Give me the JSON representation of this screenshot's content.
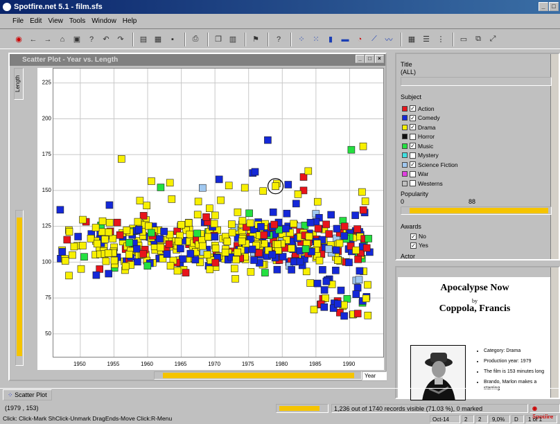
{
  "window": {
    "title": "Spotfire.net 5.1 - film.sfs"
  },
  "menu": [
    "File",
    "Edit",
    "View",
    "Tools",
    "Window",
    "Help"
  ],
  "toolbar_icons": [
    "back-icon",
    "forward-icon",
    "home-icon",
    "open-icon",
    "save-icon",
    "print-icon",
    "copy-icon",
    "paste-icon",
    "filter-icon",
    "help-icon",
    "scatter-icon",
    "bar-chart-icon",
    "pie-chart-icon",
    "line-chart-icon",
    "table-icon",
    "details-icon",
    "new-window-icon",
    "zoom-icon"
  ],
  "plot": {
    "title": "Scatter Plot - Year vs. Length",
    "y_axis_button": "Length",
    "x_axis_select": "Year",
    "tab_label": "Scatter Plot"
  },
  "chart_data": {
    "type": "scatter",
    "title": "Scatter Plot - Year vs. Length",
    "xlabel": "Year",
    "ylabel": "Length",
    "xlim": [
      1946,
      1995
    ],
    "ylim": [
      34,
      235
    ],
    "x_ticks": [
      "1950",
      "1955",
      "1960",
      "1965",
      "1970",
      "1975",
      "1980",
      "1985",
      "1990"
    ],
    "y_ticks": [
      "225",
      "200",
      "175",
      "150",
      "125",
      "100",
      "75",
      "50"
    ],
    "grid": true,
    "marker": "square",
    "series_colors": {
      "Action": "#e8141b",
      "Comedy": "#1428d8",
      "Drama": "#f8f000",
      "Music": "#24e040",
      "Science Fiction": "#a0c8f0"
    },
    "highlight": {
      "x": 1979,
      "y": 153
    }
  },
  "panel": {
    "title_label": "Title",
    "title_value": "(ALL)",
    "subject_label": "Subject",
    "subjects": [
      {
        "label": "Action",
        "color": "#e8141b",
        "checked": true
      },
      {
        "label": "Comedy",
        "color": "#1428d8",
        "checked": true
      },
      {
        "label": "Drama",
        "color": "#f8f000",
        "checked": true
      },
      {
        "label": "Horror",
        "color": "#101010",
        "checked": false
      },
      {
        "label": "Music",
        "color": "#24e040",
        "checked": true
      },
      {
        "label": "Mystery",
        "color": "#40e0e0",
        "checked": false
      },
      {
        "label": "Science Fiction",
        "color": "#a0c8f0",
        "checked": true
      },
      {
        "label": "War",
        "color": "#e040e0",
        "checked": false
      },
      {
        "label": "Westerns",
        "color": "#c0c0c0",
        "checked": false
      }
    ],
    "popularity_label": "Popularity",
    "popularity_min": "0",
    "popularity_max": "88",
    "awards_label": "Awards",
    "awards": [
      {
        "label": "No",
        "checked": true
      },
      {
        "label": "Yes",
        "checked": true
      }
    ],
    "actor_label": "Actor"
  },
  "details": {
    "movie_title": "Apocalypse Now",
    "by": "by",
    "director": "Coppola, Francis",
    "facts": [
      "Category: Drama",
      "Production year: 1979",
      "The film is 153 minutes long",
      "Brando, Marlon makes a starring"
    ]
  },
  "status": {
    "coords": "(1979 , 153)",
    "records": "1,236 out of 1740 records visible (71.03 %), 0 marked",
    "brand": "Spotfire"
  },
  "help": {
    "text": "Click: Click-Mark ShClick-Unmark DragEnds-Move Click:R-Menu",
    "cells": [
      "Oct-14",
      "2",
      "2",
      "9,0%",
      "D",
      "1 of 1"
    ]
  }
}
